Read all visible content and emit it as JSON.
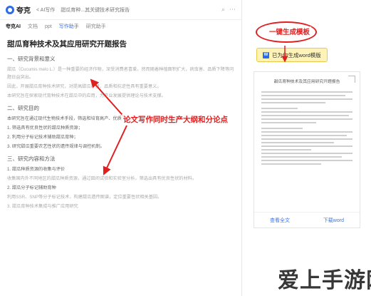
{
  "app": {
    "logo": "夸克",
    "crumb_back": "< AI写作",
    "breadcrumb": "甜瓜育种...其关键技术研究报告"
  },
  "toolbar": {
    "items": [
      "夸克AI",
      "文档",
      "ppt",
      "写作助手",
      "研究助手"
    ],
    "hint": "写作助手 ..."
  },
  "document": {
    "title": "甜瓜育种技术及其应用研究开题报告",
    "sections": [
      {
        "heading": "一、研究背景和意义",
        "paras": [
          "甜瓜（Cucumis melo L.）是一种重要的经济作物，深受消费者喜爱。然而随着种植面积扩大，病虫害、品质下降等问题日益突出。",
          "因此，开展甜瓜育种技术研究，对提高甜瓜产量、品质和抗逆性具有重要意义。",
          "本研究旨在探索现代育种技术在甜瓜中的应用，为产业发展提供理论与技术支撑。"
        ]
      },
      {
        "heading": "二、研究目的",
        "paras": [
          "本研究旨在通过现代生物技术手段，筛选和培育高产、优质、抗逆的甜瓜新品种，具体目标包括：",
          "1. 筛选具有优良性状的甜瓜种质资源；",
          "2. 利用分子标记技术辅助甜瓜育种；",
          "3. 研究甜瓜重要农艺性状的遗传规律与调控机制。"
        ]
      },
      {
        "heading": "三、研究内容和方法",
        "paras": [
          "1. 甜瓜种质资源的收集与评价",
          "收集国内外不同地区的甜瓜种质资源，通过田间试验和实验室分析，筛选出具有优良性状的材料。",
          "2. 甜瓜分子标记辅助育种",
          "利用SSR、SNP等分子标记技术，构建甜瓜遗传图谱，定位重要性状相关基因。",
          "3. 甜瓜育种技术集成与推广应用研究"
        ]
      }
    ]
  },
  "annotations": {
    "outline_callout": "论文写作同时生产大纲和分论点",
    "template_callout": "一键生成模板"
  },
  "right_panel": {
    "badge_label": "已为你生成word模版",
    "preview_title": "甜瓜育种技术及其应用研究开题报告",
    "view_full_label": "查看全文",
    "download_label": "下载word"
  },
  "watermark": "爱上手游网"
}
